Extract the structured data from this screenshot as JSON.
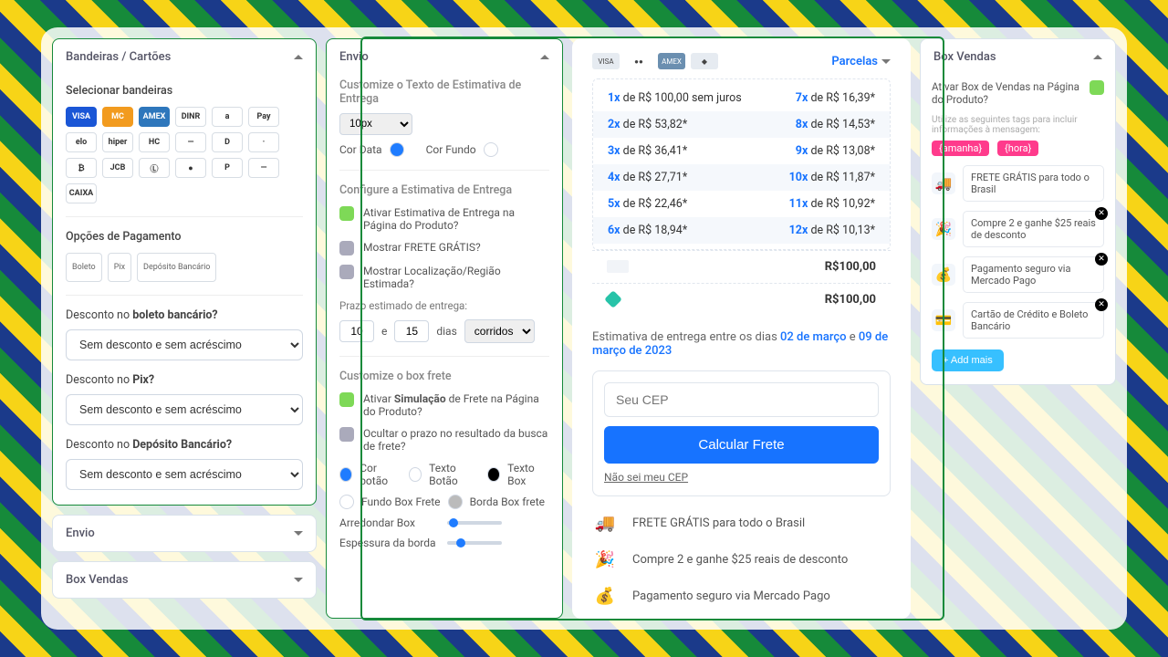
{
  "col1": {
    "panels": {
      "bandeiras": {
        "title": "Bandeiras / Cartões"
      },
      "envio": {
        "title": "Envio"
      },
      "box": {
        "title": "Box Vendas"
      }
    },
    "selecionar": "Selecionar bandeiras",
    "cards": [
      "VISA",
      "MC",
      "AMEX",
      "DINR",
      "a",
      "Pay",
      "elo",
      "hiper",
      "HC",
      "—",
      "D",
      "·",
      "₿",
      "JCB",
      "Ⓛ",
      "●",
      "P",
      "—",
      "CAIXA"
    ],
    "opcoes_pag": "Opções de Pagamento",
    "payopts": [
      "Boleto",
      "Pix",
      "Depósito Bancário"
    ],
    "disc_boleto_label_pre": "Desconto no ",
    "disc_boleto_label_b": "boleto bancário?",
    "disc_pix_label_pre": "Desconto no ",
    "disc_pix_label_b": "Pix?",
    "disc_dep_label_pre": "Desconto no ",
    "disc_dep_label_b": "Depósito Bancário?",
    "disc_option": "Sem desconto e sem acréscimo"
  },
  "col2": {
    "title": "Envio",
    "customize": "Customize o Texto de Estimativa de Entrega",
    "fontsize": "10px",
    "cor_data": "Cor Data",
    "cor_fundo": "Cor Fundo",
    "configure": "Configure a Estimativa de Entrega",
    "opt1": "Ativar Estimativa de Entrega na Página do Produto?",
    "opt2": "Mostrar FRETE GRÁTIS?",
    "opt3": "Mostrar Localização/Região Estimada?",
    "prazo": "Prazo estimado de entrega:",
    "p1": "10",
    "e": "e",
    "p2": "15",
    "dias": "dias",
    "corridos": "corridos",
    "customize_box": "Customize o box frete",
    "sim_pre": "Ativar ",
    "sim_b": "Simulação",
    "sim_post": " de Frete na Página do Produto?",
    "ocultar": "Ocultar o prazo no resultado da busca de frete?",
    "cor_botao": "Cor botão",
    "texto_botao": "Texto Botão",
    "texto_box": "Texto Box",
    "fundo_box": "Fundo Box Frete",
    "borda_box": "Borda Box frete",
    "arredondar": "Arredondar Box",
    "espessura": "Espessura da borda"
  },
  "preview": {
    "parcelas": "Parcelas",
    "rows": [
      {
        "l": "1x",
        "lt": " de R$ 100,00 sem juros",
        "r": "7x",
        "rt": " de R$ 16,39*"
      },
      {
        "l": "2x",
        "lt": " de R$ 53,82*",
        "r": "8x",
        "rt": " de R$ 14,53*"
      },
      {
        "l": "3x",
        "lt": " de R$ 36,41*",
        "r": "9x",
        "rt": " de R$ 13,08*"
      },
      {
        "l": "4x",
        "lt": " de R$ 27,71*",
        "r": "10x",
        "rt": " de R$ 11,87*"
      },
      {
        "l": "5x",
        "lt": " de R$ 22,46*",
        "r": "11x",
        "rt": " de R$ 10,92*"
      },
      {
        "l": "6x",
        "lt": " de R$ 18,94*",
        "r": "12x",
        "rt": " de R$ 10,13*"
      }
    ],
    "total": "R$100,00",
    "est_pre": "Estimativa de entrega entre os dias ",
    "d1": "02 de março",
    "e": " e ",
    "d2": "09 de março de 2023",
    "cep_ph": "Seu CEP",
    "calc": "Calcular Frete",
    "naosei": "Não sei meu CEP",
    "feat": [
      {
        "ico": "🚚",
        "txt": "FRETE GRÁTIS para todo o Brasil"
      },
      {
        "ico": "🎉",
        "txt": "Compre 2 e ganhe $25 reais de desconto"
      },
      {
        "ico": "💰",
        "txt": "Pagamento seguro via Mercado Pago"
      },
      {
        "ico": "💳",
        "txt": "Cartão de Crédito e Boleto Bancário"
      }
    ]
  },
  "col4": {
    "title": "Box Vendas",
    "activate": "Ativar Box de Vendas na Página do Produto?",
    "taghint": "Utilize as seguintes tags para incluir informações à mensagem:",
    "tagA": "{amanha}",
    "tagB": "{hora}",
    "cards": [
      {
        "ico": "🚚",
        "txt": "FRETE GRÁTIS para todo o Brasil"
      },
      {
        "ico": "🎉",
        "txt": "Compre 2 e ganhe $25 reais de desconto"
      },
      {
        "ico": "💰",
        "txt": "Pagamento seguro via Mercado Pago"
      },
      {
        "ico": "💳",
        "txt": "Cartão de Crédito e Boleto Bancário"
      }
    ],
    "add": "+ Add mais"
  }
}
